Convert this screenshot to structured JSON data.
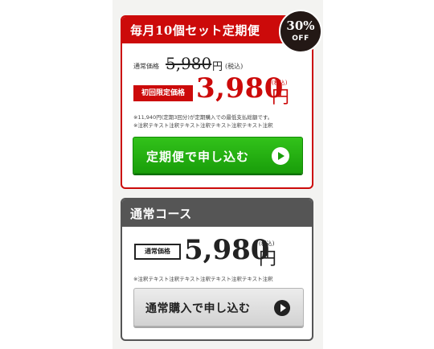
{
  "subscription": {
    "title": "毎月10個セット定期便",
    "badge": {
      "percent": "30%",
      "off": "OFF"
    },
    "regular_label": "通常価格",
    "regular_price": "5,980",
    "regular_yen": "円",
    "regular_tax": "(税込)",
    "first_badge": "初回限定価格",
    "price": "3,980",
    "yen": "円",
    "tax": "(税込)",
    "note1": "※11,940円(定期3回分)が定期購入での最低支払総額です。",
    "note2": "※注釈テキスト注釈テキスト注釈テキスト注釈テキスト注釈",
    "button_label": "定期便で申し込む",
    "accent": "#cc0a0a",
    "button_color": "#1fab0e"
  },
  "regular": {
    "title": "通常コース",
    "label": "通常価格",
    "price": "5,980",
    "yen": "円",
    "tax": "(税込)",
    "note": "※注釈テキスト注釈テキスト注釈テキスト注釈テキスト注釈",
    "button_label": "通常購入で申し込む",
    "header_color": "#555555"
  }
}
